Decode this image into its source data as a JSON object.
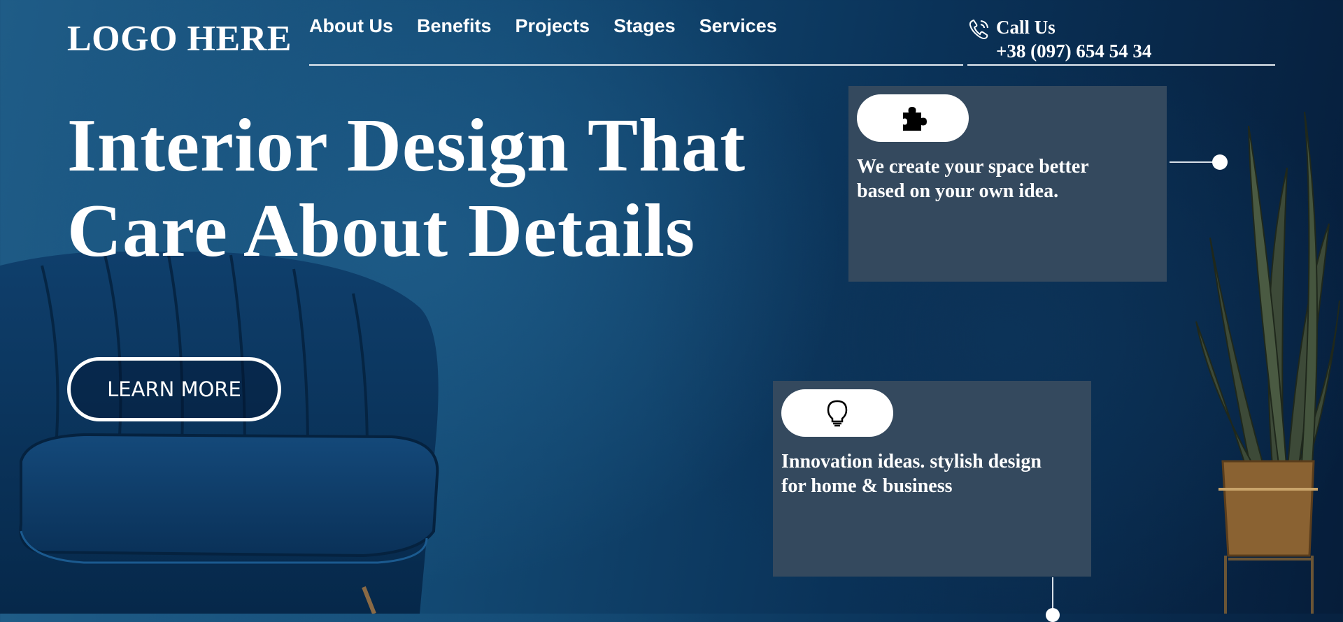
{
  "header": {
    "logo": "LOGO HERE",
    "nav": [
      "About Us",
      "Benefits",
      "Projects",
      "Stages",
      "Services"
    ],
    "call": {
      "title": "Call Us",
      "phone": "+38 (097) 654 54 34",
      "icon": "phone-icon"
    }
  },
  "hero": {
    "title_line1": "Interior Design That",
    "title_line2": "Care About Details",
    "cta": "LEARN MORE"
  },
  "features": [
    {
      "icon": "puzzle-icon",
      "text": "We create your space better based on your own idea."
    },
    {
      "icon": "lightbulb-icon",
      "text": "Innovation ideas. stylish design for home & business"
    }
  ],
  "colors": {
    "background": "#134a74",
    "card": "#34495e",
    "text": "#ffffff"
  }
}
